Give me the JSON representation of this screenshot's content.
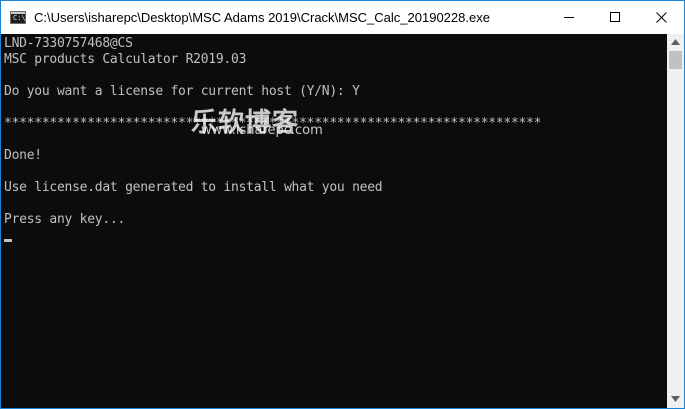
{
  "window": {
    "title": "C:\\Users\\isharepc\\Desktop\\MSC Adams 2019\\Crack\\MSC_Calc_20190228.exe",
    "icon": "console-app-icon",
    "icon_prompt": "C:\\",
    "controls": {
      "minimize_icon": "minimize-icon",
      "maximize_icon": "maximize-icon",
      "close_icon": "close-icon"
    }
  },
  "console": {
    "lines": [
      "LND-7330757468@CS",
      "MSC products Calculator R2019.03",
      "Do you want a license for current host (Y/N): Y",
      "***********************************************************************",
      "Done!",
      "Use license.dat generated to install what you need",
      "Press any key..."
    ],
    "text_color": "#c0c0c0",
    "background_color": "#0c0c0c"
  },
  "watermark": {
    "chinese": "乐软博客",
    "url": "www.isharepc.com"
  },
  "scrollbar": {
    "up_icon": "scroll-up-arrow-icon",
    "down_icon": "scroll-down-arrow-icon"
  }
}
